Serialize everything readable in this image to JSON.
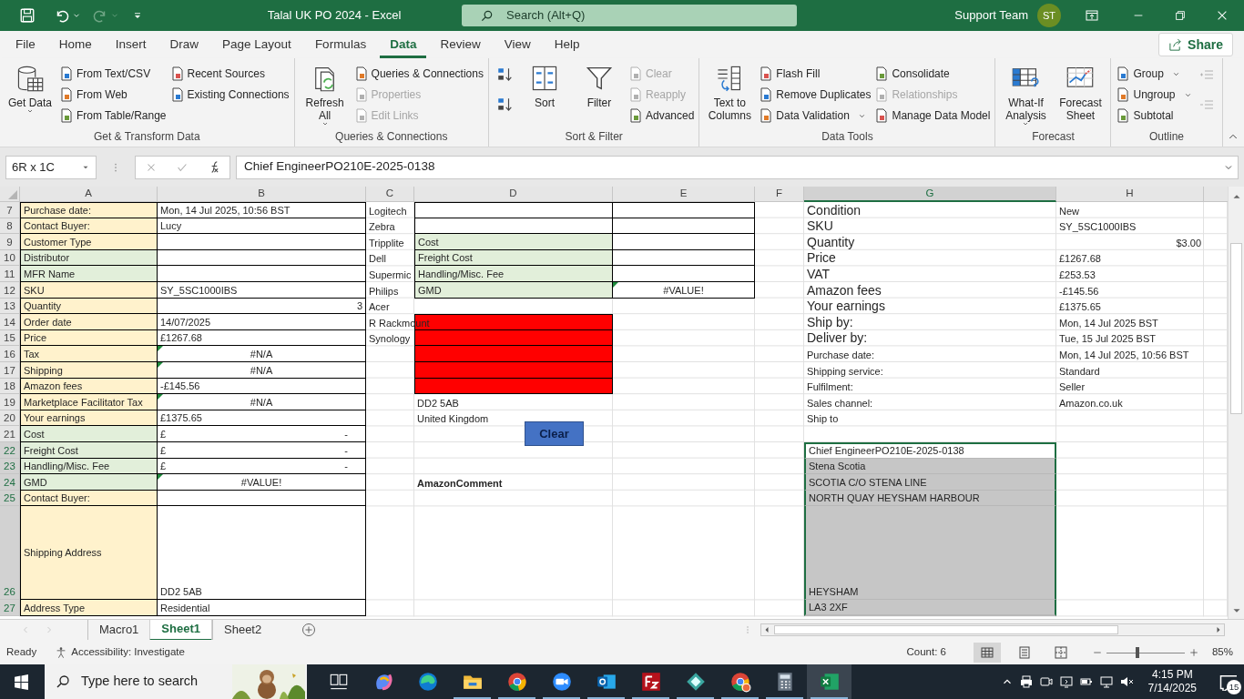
{
  "title_bar": {
    "title": "Talal UK PO 2024  -  Excel",
    "search_placeholder": "Search (Alt+Q)",
    "user": "Support Team",
    "avatar": "ST"
  },
  "menu_tabs": [
    {
      "label": "File",
      "selected": false
    },
    {
      "label": "Home",
      "selected": false
    },
    {
      "label": "Insert",
      "selected": false
    },
    {
      "label": "Draw",
      "selected": false
    },
    {
      "label": "Page Layout",
      "selected": false
    },
    {
      "label": "Formulas",
      "selected": false
    },
    {
      "label": "Data",
      "selected": true
    },
    {
      "label": "Review",
      "selected": false
    },
    {
      "label": "View",
      "selected": false
    },
    {
      "label": "Help",
      "selected": false
    }
  ],
  "share": "Share",
  "ribbon": {
    "groups": [
      {
        "label": "Get & Transform Data",
        "columns": [
          [
            {
              "label": "Get Data",
              "kind": "large",
              "dropdown": true,
              "disabled": false
            }
          ],
          [
            {
              "label": "From Text/CSV",
              "kind": "small",
              "dropdown": false,
              "disabled": false
            },
            {
              "label": "From Web",
              "kind": "small",
              "dropdown": false,
              "disabled": false
            },
            {
              "label": "From Table/Range",
              "kind": "small",
              "dropdown": false,
              "disabled": false
            }
          ],
          [
            {
              "label": "Recent Sources",
              "kind": "small",
              "dropdown": false,
              "disabled": false
            },
            {
              "label": "Existing Connections",
              "kind": "small",
              "dropdown": false,
              "disabled": false
            }
          ]
        ]
      },
      {
        "label": "Queries & Connections",
        "columns": [
          [
            {
              "label": "Refresh All",
              "kind": "large",
              "dropdown": true,
              "disabled": false
            }
          ],
          [
            {
              "label": "Queries & Connections",
              "kind": "small",
              "dropdown": false,
              "disabled": false
            },
            {
              "label": "Properties",
              "kind": "small",
              "dropdown": false,
              "disabled": true
            },
            {
              "label": "Edit Links",
              "kind": "small",
              "dropdown": false,
              "disabled": true
            }
          ]
        ]
      },
      {
        "label": "Sort & Filter",
        "columns": [
          [
            {
              "kind": "icon",
              "disabled": false
            },
            {
              "kind": "icon",
              "disabled": false
            }
          ],
          [
            {
              "label": "Sort",
              "kind": "large",
              "dropdown": false,
              "disabled": false
            }
          ],
          [
            {
              "label": "Filter",
              "kind": "large",
              "dropdown": false,
              "disabled": false
            }
          ],
          [
            {
              "label": "Clear",
              "kind": "small",
              "dropdown": false,
              "disabled": true
            },
            {
              "label": "Reapply",
              "kind": "small",
              "dropdown": false,
              "disabled": true
            },
            {
              "label": "Advanced",
              "kind": "small",
              "dropdown": false,
              "disabled": false
            }
          ]
        ]
      },
      {
        "label": "Data Tools",
        "columns": [
          [
            {
              "label": "Text to Columns",
              "kind": "large",
              "dropdown": false,
              "disabled": false
            }
          ],
          [
            {
              "label": "Flash Fill",
              "kind": "small",
              "dropdown": false,
              "disabled": false
            },
            {
              "label": "Remove Duplicates",
              "kind": "small",
              "dropdown": false,
              "disabled": false
            },
            {
              "label": "Data Validation",
              "kind": "small",
              "dropdown": true,
              "disabled": false
            }
          ],
          [
            {
              "label": "Consolidate",
              "kind": "small",
              "dropdown": false,
              "disabled": false
            },
            {
              "label": "Relationships",
              "kind": "small",
              "dropdown": false,
              "disabled": true
            },
            {
              "label": "Manage Data Model",
              "kind": "small",
              "dropdown": false,
              "disabled": false
            }
          ]
        ]
      },
      {
        "label": "Forecast",
        "columns": [
          [
            {
              "label": "What-If Analysis",
              "kind": "large",
              "dropdown": true,
              "disabled": false
            }
          ],
          [
            {
              "label": "Forecast Sheet",
              "kind": "large",
              "dropdown": false,
              "disabled": false
            }
          ]
        ]
      },
      {
        "label": "Outline",
        "columns": [
          [
            {
              "label": "Group",
              "kind": "small",
              "dropdown": true,
              "disabled": false
            },
            {
              "label": "Ungroup",
              "kind": "small",
              "dropdown": true,
              "disabled": false
            },
            {
              "label": "Subtotal",
              "kind": "small",
              "dropdown": false,
              "disabled": false
            }
          ],
          [
            {
              "kind": "icon",
              "disabled": true
            },
            {
              "kind": "icon",
              "disabled": true
            }
          ]
        ]
      }
    ]
  },
  "formula_bar": {
    "name_box": "6R x 1C",
    "formula": "Chief EngineerPO210E-2025-0138"
  },
  "sheet": {
    "columns": [
      "A",
      "B",
      "C",
      "D",
      "E",
      "F",
      "G",
      "H"
    ],
    "rows": [
      {
        "row": "7",
        "cells": [
          {
            "text": "Purchase date:",
            "color": "#fff2cc"
          },
          {
            "text": "Mon, 14 Jul 2025, 10:56 BST",
            "color": "#ffffff"
          },
          {
            "text": "Logitech"
          },
          {
            "color": "#ffffff"
          },
          {
            "color": "#ffffff"
          },
          {},
          {
            "text": "Condition",
            "large": true
          },
          {
            "text": "New"
          }
        ]
      },
      {
        "row": "8",
        "cells": [
          {
            "text": "Contact Buyer:",
            "color": "#fff2cc"
          },
          {
            "text": "Lucy",
            "color": "#ffffff"
          },
          {
            "text": "Zebra"
          },
          {
            "color": "#ffffff"
          },
          {
            "color": "#ffffff"
          },
          {},
          {
            "text": "SKU",
            "large": true
          },
          {
            "text": "SY_5SC1000IBS"
          }
        ]
      },
      {
        "row": "9",
        "cells": [
          {
            "text": "Customer Type",
            "color": "#fff2cc"
          },
          {
            "color": "#ffffff"
          },
          {
            "text": "Tripplite"
          },
          {
            "text": "Cost",
            "color": "#e2efda"
          },
          {
            "color": "#ffffff"
          },
          {},
          {
            "text": "Quantity",
            "large": true
          },
          {
            "text": "$3.00",
            "kind": "number"
          }
        ]
      },
      {
        "row": "10",
        "cells": [
          {
            "text": "Distributor",
            "color": "#e2efda"
          },
          {
            "color": "#ffffff"
          },
          {
            "text": "Dell"
          },
          {
            "text": "Freight Cost",
            "color": "#e2efda"
          },
          {
            "color": "#ffffff"
          },
          {},
          {
            "text": "Price",
            "large": true
          },
          {
            "text": "£1267.68"
          }
        ]
      },
      {
        "row": "11",
        "cells": [
          {
            "text": "MFR Name",
            "color": "#e2efda"
          },
          {
            "color": "#ffffff"
          },
          {
            "text": "Supermic"
          },
          {
            "text": "Handling/Misc. Fee",
            "color": "#e2efda"
          },
          {
            "color": "#ffffff"
          },
          {},
          {
            "text": "VAT",
            "large": true
          },
          {
            "text": "£253.53"
          }
        ]
      },
      {
        "row": "12",
        "cells": [
          {
            "text": "SKU",
            "color": "#fff2cc"
          },
          {
            "text": "SY_5SC1000IBS",
            "color": "#ffffff"
          },
          {
            "text": "Philips"
          },
          {
            "text": "GMD",
            "color": "#e2efda"
          },
          {
            "text": "#VALUE!",
            "kind": "error",
            "color": "#ffffff",
            "error_flag": true
          },
          {},
          {
            "text": "Amazon fees",
            "large": true
          },
          {
            "text": "-£145.56"
          }
        ]
      },
      {
        "row": "13",
        "cells": [
          {
            "text": "Quantity",
            "color": "#fff2cc"
          },
          {
            "text": "3",
            "kind": "number",
            "color": "#ffffff"
          },
          {
            "text": "Acer"
          },
          {},
          {},
          {},
          {
            "text": "Your earnings",
            "large": true
          },
          {
            "text": "£1375.65"
          }
        ]
      },
      {
        "row": "14",
        "cells": [
          {
            "text": "Order date",
            "color": "#fff2cc"
          },
          {
            "text": "14/07/2025",
            "color": "#ffffff"
          },
          {
            "text": "R Rackmount"
          },
          {
            "color": "#ff0000"
          },
          {},
          {},
          {
            "text": "Ship by:",
            "large": true
          },
          {
            "text": "Mon, 14 Jul 2025 BST"
          }
        ]
      },
      {
        "row": "15",
        "cells": [
          {
            "text": "Price",
            "color": "#fff2cc"
          },
          {
            "text": "£1267.68",
            "color": "#ffffff"
          },
          {
            "text": "Synology"
          },
          {
            "color": "#ff0000"
          },
          {},
          {},
          {
            "text": "Deliver by:",
            "large": true
          },
          {
            "text": "Tue, 15 Jul 2025 BST"
          }
        ]
      },
      {
        "row": "16",
        "cells": [
          {
            "text": "Tax",
            "color": "#fff2cc"
          },
          {
            "text": "#N/A",
            "kind": "error",
            "color": "#ffffff",
            "error_flag": true
          },
          {},
          {
            "color": "#ff0000"
          },
          {},
          {},
          {
            "text": "Purchase date:"
          },
          {
            "text": "Mon, 14 Jul 2025, 10:56 BST"
          }
        ]
      },
      {
        "row": "17",
        "cells": [
          {
            "text": "Shipping",
            "color": "#fff2cc"
          },
          {
            "text": "#N/A",
            "kind": "error",
            "color": "#ffffff",
            "error_flag": true
          },
          {},
          {
            "color": "#ff0000"
          },
          {},
          {},
          {
            "text": "Shipping service:"
          },
          {
            "text": "Standard"
          }
        ]
      },
      {
        "row": "18",
        "cells": [
          {
            "text": "Amazon fees",
            "color": "#fff2cc"
          },
          {
            "text": "-£145.56",
            "color": "#ffffff"
          },
          {},
          {
            "color": "#ff0000"
          },
          {},
          {},
          {
            "text": "Fulfilment:"
          },
          {
            "text": "Seller"
          }
        ]
      },
      {
        "row": "19",
        "cells": [
          {
            "text": "Marketplace Facilitator Tax",
            "color": "#fff2cc"
          },
          {
            "text": "#N/A",
            "kind": "error",
            "color": "#ffffff",
            "error_flag": true
          },
          {},
          {
            "text": "DD2 5AB"
          },
          {},
          {},
          {
            "text": "Sales channel:"
          },
          {
            "text": "Amazon.co.uk"
          }
        ]
      },
      {
        "row": "20",
        "cells": [
          {
            "text": "Your earnings",
            "color": "#fff2cc"
          },
          {
            "text": "£1375.65",
            "color": "#ffffff"
          },
          {},
          {
            "text": "United Kingdom"
          },
          {},
          {},
          {
            "text": "Ship to"
          },
          {}
        ]
      },
      {
        "row": "21",
        "cells": [
          {
            "text": "Cost",
            "color": "#e2efda"
          },
          {
            "text": "£",
            "end_text": "-",
            "color": "#ffffff"
          },
          {},
          {},
          {},
          {},
          {},
          {}
        ]
      },
      {
        "row": "22",
        "cells": [
          {
            "text": "Freight Cost",
            "color": "#e2efda"
          },
          {
            "text": "£",
            "end_text": "-",
            "color": "#ffffff"
          },
          {},
          {},
          {},
          {},
          {
            "text": "Chief EngineerPO210E-2025-0138",
            "selected": true,
            "active": true
          },
          {}
        ]
      },
      {
        "row": "23",
        "cells": [
          {
            "text": "Handling/Misc. Fee",
            "color": "#e2efda"
          },
          {
            "text": "£",
            "end_text": "-",
            "color": "#ffffff"
          },
          {},
          {},
          {},
          {},
          {
            "text": "Stena Scotia",
            "selected": true,
            "active": false
          },
          {}
        ]
      },
      {
        "row": "24",
        "cells": [
          {
            "text": "GMD",
            "color": "#e2efda"
          },
          {
            "text": "#VALUE!",
            "kind": "error",
            "color": "#ffffff",
            "error_flag": true
          },
          {},
          {
            "text": "AmazonComment",
            "bold": true
          },
          {},
          {},
          {
            "text": "SCOTIA C/O STENA LINE",
            "selected": true,
            "active": false
          },
          {}
        ]
      },
      {
        "row": "25",
        "cells": [
          {
            "text": "Contact Buyer:",
            "color": "#fff2cc"
          },
          {
            "color": "#ffffff"
          },
          {},
          {},
          {},
          {},
          {
            "text": "NORTH QUAY HEYSHAM HARBOUR",
            "selected": true,
            "active": false
          },
          {}
        ]
      },
      {
        "row": "26",
        "cells": [
          {
            "text": "Shipping Address",
            "color": "#fff2cc",
            "kind": "merged"
          },
          {
            "text": "DD2 5AB",
            "color": "#ffffff"
          },
          {},
          {},
          {},
          {},
          {
            "text": "HEYSHAM",
            "selected": true,
            "active": false
          },
          {}
        ]
      },
      {
        "row": "27",
        "cells": [
          {
            "text": "Address Type",
            "color": "#fff2cc"
          },
          {
            "text": "Residential",
            "color": "#ffffff"
          },
          {},
          {},
          {},
          {},
          {
            "text": "LA3 2XF",
            "selected": true,
            "active": false
          },
          {}
        ]
      }
    ],
    "shapes": [
      {
        "label": "Clear"
      }
    ]
  },
  "sheet_tabs": [
    {
      "label": "Macro1",
      "selected": false
    },
    {
      "label": "Sheet1",
      "selected": true
    },
    {
      "label": "Sheet2",
      "selected": false
    }
  ],
  "status_bar": {
    "mode": "Ready",
    "accessibility": "Accessibility: Investigate",
    "count": "Count: 6",
    "zoom": {
      "level": 0.39,
      "reading": "85%"
    }
  },
  "taskbar": {
    "search_placeholder": "Type here to search",
    "apps": [
      {
        "running": false,
        "selected": false
      },
      {
        "running": false,
        "selected": false
      },
      {
        "running": false,
        "selected": false
      },
      {
        "running": true,
        "selected": false
      },
      {
        "running": true,
        "selected": false
      },
      {
        "running": true,
        "selected": false
      },
      {
        "running": true,
        "selected": false
      },
      {
        "running": true,
        "selected": false
      },
      {
        "running": true,
        "selected": false
      },
      {
        "running": true,
        "selected": false
      },
      {
        "running": true,
        "selected": false
      },
      {
        "running": true,
        "selected": true
      }
    ],
    "time": "4:15 PM",
    "date": "7/14/2025",
    "notifications": "15"
  }
}
